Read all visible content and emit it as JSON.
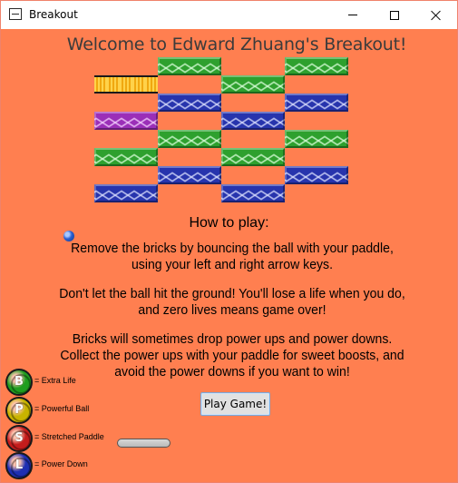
{
  "window": {
    "title": "Breakout",
    "background": "#ff7f50"
  },
  "game": {
    "welcome": "Welcome to Edward Zhuang's Breakout!",
    "how_to_play_title": "How to play:",
    "instructions": [
      "Remove the bricks by bouncing the ball with your paddle, using your left and right arrow keys.",
      "Don't let the ball hit the ground! You'll lose a life when you do, and zero lives means game over!",
      "Bricks will sometimes drop power ups and power downs. Collect the power ups with your paddle for sweet boosts, and avoid the power downs if you want to win!"
    ],
    "play_button": "Play Game!"
  },
  "bricks": {
    "colors": {
      "green": "#2ea02e",
      "blue": "#2734ad",
      "purple": "#9b2fb8",
      "gold": "#f2b418"
    },
    "rows": [
      [
        "empty",
        "green",
        "empty",
        "green"
      ],
      [
        "gold",
        "empty",
        "green",
        "empty"
      ],
      [
        "empty",
        "blue",
        "empty",
        "blue"
      ],
      [
        "purple",
        "empty",
        "blue",
        "empty"
      ],
      [
        "empty",
        "green",
        "empty",
        "green"
      ],
      [
        "green",
        "empty",
        "green",
        "empty"
      ],
      [
        "empty",
        "blue",
        "empty",
        "blue"
      ],
      [
        "blue",
        "empty",
        "blue",
        "empty"
      ]
    ]
  },
  "legend": [
    {
      "letter": "B",
      "label": "= Extra Life",
      "color": "#1f9e1f",
      "icon": "extra-life-powerup-icon"
    },
    {
      "letter": "P",
      "label": "= Powerful Ball",
      "color": "#c8b400",
      "icon": "powerful-ball-powerup-icon"
    },
    {
      "letter": "S",
      "label": "= Stretched Paddle",
      "color": "#c41c1c",
      "icon": "stretched-paddle-powerup-icon"
    },
    {
      "letter": "L",
      "label": "= Power Down",
      "color": "#1e2fb3",
      "icon": "power-down-icon"
    }
  ]
}
